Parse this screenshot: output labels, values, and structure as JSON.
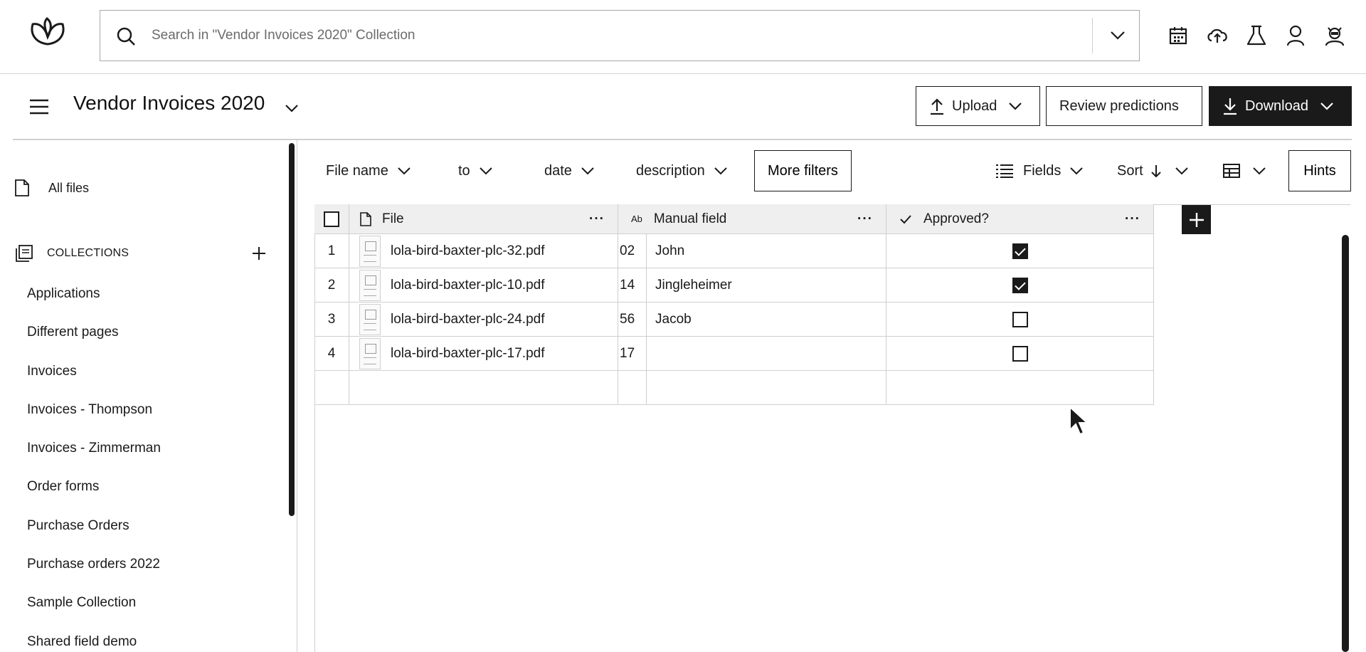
{
  "topbar": {
    "search_placeholder": "Search in \"Vendor Invoices 2020\" Collection",
    "icons": [
      "calendar-icon",
      "cloud-link-icon",
      "flask-icon",
      "user-icon",
      "bot-icon"
    ]
  },
  "header": {
    "collection_title": "Vendor Invoices 2020",
    "upload_label": "Upload",
    "review_label": "Review predictions",
    "download_label": "Download"
  },
  "sidebar": {
    "all_files": "All files",
    "collections_heading": "COLLECTIONS",
    "items": [
      "Applications",
      "Different pages",
      "Invoices",
      "Invoices - Thompson",
      "Invoices - Zimmerman",
      "Order forms",
      "Purchase Orders",
      "Purchase orders 2022",
      "Sample Collection",
      "Shared field demo"
    ]
  },
  "filters": {
    "file_name": "File name",
    "to": "to",
    "date": "date",
    "description": "description",
    "more_filters": "More filters",
    "fields": "Fields",
    "sort": "Sort",
    "hints": "Hints"
  },
  "table": {
    "columns": {
      "file": "File",
      "manual_field": "Manual field",
      "manual_field_type": "Ab",
      "approved": "Approved?"
    },
    "rows": [
      {
        "num": "1",
        "file": "lola-bird-baxter-plc-32.pdf",
        "partial": "02",
        "manual": "John",
        "approved": true
      },
      {
        "num": "2",
        "file": "lola-bird-baxter-plc-10.pdf",
        "partial": "14",
        "manual": "Jingleheimer",
        "approved": true
      },
      {
        "num": "3",
        "file": "lola-bird-baxter-plc-24.pdf",
        "partial": "56",
        "manual": "Jacob",
        "approved": false
      },
      {
        "num": "4",
        "file": "lola-bird-baxter-plc-17.pdf",
        "partial": "17",
        "manual": "",
        "approved": false
      }
    ]
  },
  "colors": {
    "dark": "#1a1a1a",
    "border": "#cfcfcf",
    "header_bg": "#efefef"
  }
}
